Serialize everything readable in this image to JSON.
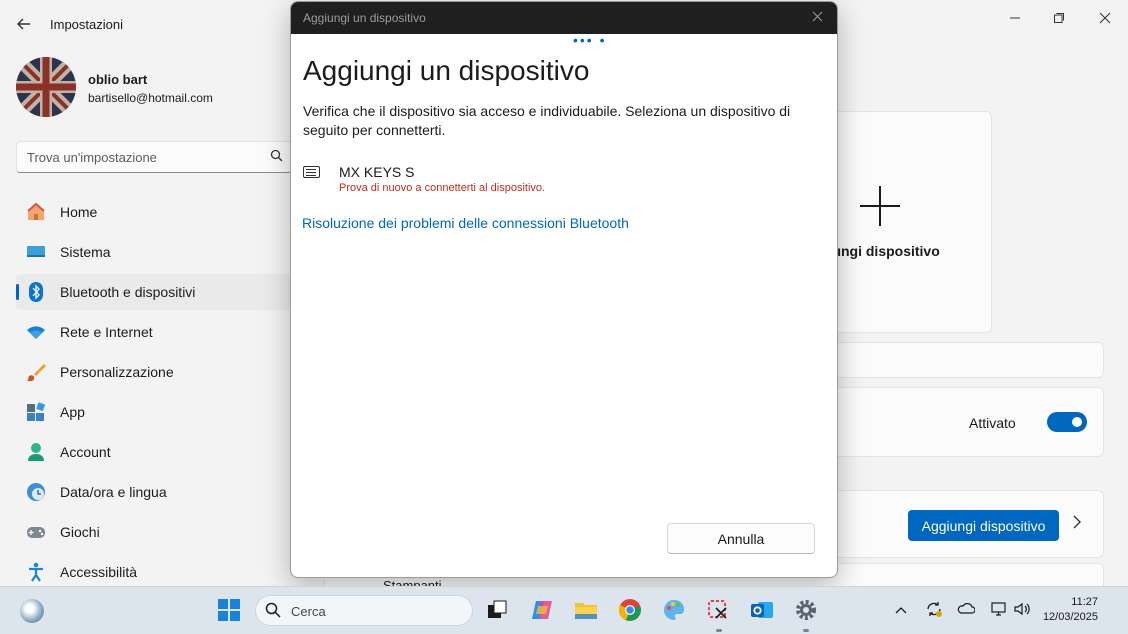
{
  "window": {
    "title": "Impostazioni",
    "controls": [
      "minimize-icon",
      "maximize-icon",
      "close-icon"
    ]
  },
  "user": {
    "name": "oblio bart",
    "email": "bartisello@hotmail.com"
  },
  "search": {
    "placeholder": "Trova un'impostazione"
  },
  "sidebar": {
    "items": [
      {
        "label": "Home",
        "icon": "home-icon"
      },
      {
        "label": "Sistema",
        "icon": "system-icon"
      },
      {
        "label": "Bluetooth e dispositivi",
        "icon": "bluetooth-icon",
        "active": true
      },
      {
        "label": "Rete e Internet",
        "icon": "wifi-icon"
      },
      {
        "label": "Personalizzazione",
        "icon": "brush-icon"
      },
      {
        "label": "App",
        "icon": "apps-icon"
      },
      {
        "label": "Account",
        "icon": "account-icon"
      },
      {
        "label": "Data/ora e lingua",
        "icon": "time-language-icon"
      },
      {
        "label": "Giochi",
        "icon": "gamepad-icon"
      },
      {
        "label": "Accessibilità",
        "icon": "accessibility-icon"
      }
    ]
  },
  "main": {
    "add_card_label": "giungi dispositivo",
    "bluetooth_state": "Attivato",
    "add_device_button": "Aggiungi dispositivo",
    "bottom_cut_text": "Stampanti"
  },
  "dialog": {
    "titlebar": "Aggiungi un dispositivo",
    "heading": "Aggiungi un dispositivo",
    "description": "Verifica che il dispositivo sia acceso e individuabile. Seleziona un dispositivo di seguito per connetterti.",
    "device": {
      "name": "MX KEYS S",
      "error": "Prova di nuovo a connetterti al dispositivo."
    },
    "troubleshoot_link": "Risoluzione dei problemi delle connessioni Bluetooth",
    "cancel_button": "Annulla"
  },
  "taskbar": {
    "search_placeholder": "Cerca",
    "time": "11:27",
    "date": "12/03/2025"
  },
  "colors": {
    "accent": "#0067c0",
    "error": "#c42b1c",
    "dialog_titlebar": "#1f1f1f"
  }
}
